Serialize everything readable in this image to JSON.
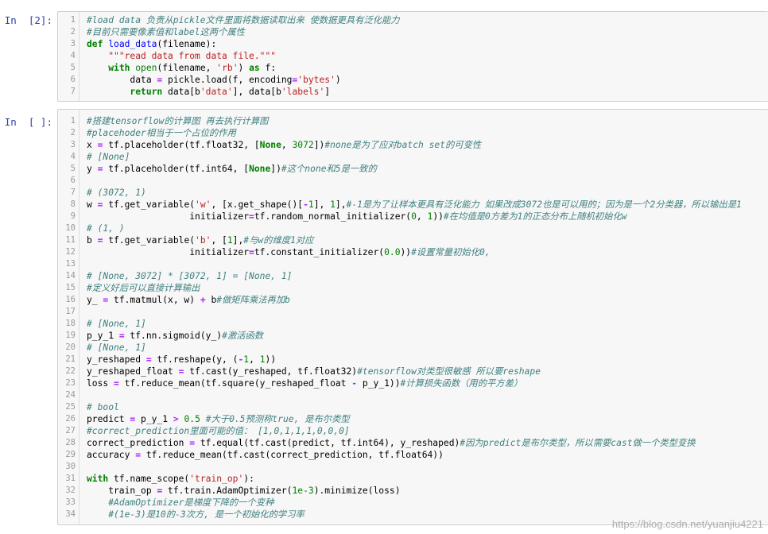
{
  "cells": [
    {
      "prompt": "In  [2]:",
      "lines": [
        [
          {
            "t": "#load data 负责从pickle文件里面将数据读取出来 使数据更具有泛化能力",
            "c": "cm"
          }
        ],
        [
          {
            "t": "#目前只需要像素值和label这两个属性",
            "c": "cm"
          }
        ],
        [
          {
            "t": "def",
            "c": "kw"
          },
          {
            "t": " "
          },
          {
            "t": "load_data",
            "c": "fn"
          },
          {
            "t": "(filename):"
          }
        ],
        [
          {
            "t": "    "
          },
          {
            "t": "\"\"\"read data from data file.\"\"\"",
            "c": "str"
          }
        ],
        [
          {
            "t": "    "
          },
          {
            "t": "with",
            "c": "kw"
          },
          {
            "t": " "
          },
          {
            "t": "open",
            "c": "bi"
          },
          {
            "t": "(filename, "
          },
          {
            "t": "'rb'",
            "c": "str"
          },
          {
            "t": ") "
          },
          {
            "t": "as",
            "c": "kw"
          },
          {
            "t": " f:"
          }
        ],
        [
          {
            "t": "        data "
          },
          {
            "t": "=",
            "c": "op"
          },
          {
            "t": " pickle.load(f, encoding"
          },
          {
            "t": "=",
            "c": "op"
          },
          {
            "t": "'bytes'",
            "c": "str"
          },
          {
            "t": ")"
          }
        ],
        [
          {
            "t": "        "
          },
          {
            "t": "return",
            "c": "kw"
          },
          {
            "t": " data[b"
          },
          {
            "t": "'data'",
            "c": "str"
          },
          {
            "t": "], data[b"
          },
          {
            "t": "'labels'",
            "c": "str"
          },
          {
            "t": "]"
          }
        ]
      ]
    },
    {
      "prompt": "In  [ ]:",
      "lines": [
        [
          {
            "t": "#搭建tensorflow的计算图 再去执行计算图",
            "c": "cm"
          }
        ],
        [
          {
            "t": "#placehoder相当于一个占位的作用",
            "c": "cm"
          }
        ],
        [
          {
            "t": "x "
          },
          {
            "t": "=",
            "c": "op"
          },
          {
            "t": " tf.placeholder(tf.float32, ["
          },
          {
            "t": "None",
            "c": "kw"
          },
          {
            "t": ", "
          },
          {
            "t": "3072",
            "c": "num"
          },
          {
            "t": "])"
          },
          {
            "t": "#none是为了应对batch set的可变性",
            "c": "cm"
          }
        ],
        [
          {
            "t": "# [None]",
            "c": "cm"
          }
        ],
        [
          {
            "t": "y "
          },
          {
            "t": "=",
            "c": "op"
          },
          {
            "t": " tf.placeholder(tf.int64, ["
          },
          {
            "t": "None",
            "c": "kw"
          },
          {
            "t": "])"
          },
          {
            "t": "#这个none和5是一致的",
            "c": "cm"
          }
        ],
        [
          {
            "t": ""
          }
        ],
        [
          {
            "t": "# (3072, 1)",
            "c": "cm"
          }
        ],
        [
          {
            "t": "w "
          },
          {
            "t": "=",
            "c": "op"
          },
          {
            "t": " tf.get_variable("
          },
          {
            "t": "'w'",
            "c": "str"
          },
          {
            "t": ", [x.get_shape()["
          },
          {
            "t": "-",
            "c": "op"
          },
          {
            "t": "1",
            "c": "num"
          },
          {
            "t": "], "
          },
          {
            "t": "1",
            "c": "num"
          },
          {
            "t": "],"
          },
          {
            "t": "#-1是为了让样本更具有泛化能力 如果改成3072也是可以用的；因为是一个2分类器，所以输出是1",
            "c": "cm"
          }
        ],
        [
          {
            "t": "                   initializer"
          },
          {
            "t": "=",
            "c": "op"
          },
          {
            "t": "tf.random_normal_initializer("
          },
          {
            "t": "0",
            "c": "num"
          },
          {
            "t": ", "
          },
          {
            "t": "1",
            "c": "num"
          },
          {
            "t": "))"
          },
          {
            "t": "#在均值是0方差为1的正态分布上随机初始化w",
            "c": "cm"
          }
        ],
        [
          {
            "t": "# (1, )",
            "c": "cm"
          }
        ],
        [
          {
            "t": "b "
          },
          {
            "t": "=",
            "c": "op"
          },
          {
            "t": " tf.get_variable("
          },
          {
            "t": "'b'",
            "c": "str"
          },
          {
            "t": ", ["
          },
          {
            "t": "1",
            "c": "num"
          },
          {
            "t": "],"
          },
          {
            "t": "#与w的维度1对应",
            "c": "cm"
          }
        ],
        [
          {
            "t": "                   initializer"
          },
          {
            "t": "=",
            "c": "op"
          },
          {
            "t": "tf.constant_initializer("
          },
          {
            "t": "0.0",
            "c": "num"
          },
          {
            "t": "))"
          },
          {
            "t": "#设置常量初始化0,",
            "c": "cm"
          }
        ],
        [
          {
            "t": ""
          }
        ],
        [
          {
            "t": "# [None, 3072] * [3072, 1] = [None, 1]",
            "c": "cm"
          }
        ],
        [
          {
            "t": "#定义好后可以直接计算输出",
            "c": "cm"
          }
        ],
        [
          {
            "t": "y_ "
          },
          {
            "t": "=",
            "c": "op"
          },
          {
            "t": " tf.matmul(x, w) "
          },
          {
            "t": "+",
            "c": "op"
          },
          {
            "t": " b"
          },
          {
            "t": "#做矩阵乘法再加b",
            "c": "cm"
          }
        ],
        [
          {
            "t": ""
          }
        ],
        [
          {
            "t": "# [None, 1]",
            "c": "cm"
          }
        ],
        [
          {
            "t": "p_y_1 "
          },
          {
            "t": "=",
            "c": "op"
          },
          {
            "t": " tf.nn.sigmoid(y_)"
          },
          {
            "t": "#激活函数",
            "c": "cm"
          }
        ],
        [
          {
            "t": "# [None, 1]",
            "c": "cm"
          }
        ],
        [
          {
            "t": "y_reshaped "
          },
          {
            "t": "=",
            "c": "op"
          },
          {
            "t": " tf.reshape(y, ("
          },
          {
            "t": "-",
            "c": "op"
          },
          {
            "t": "1",
            "c": "num"
          },
          {
            "t": ", "
          },
          {
            "t": "1",
            "c": "num"
          },
          {
            "t": "))"
          }
        ],
        [
          {
            "t": "y_reshaped_float "
          },
          {
            "t": "=",
            "c": "op"
          },
          {
            "t": " tf.cast(y_reshaped, tf.float32)"
          },
          {
            "t": "#tensorflow对类型很敏感 所以要reshape",
            "c": "cm"
          }
        ],
        [
          {
            "t": "loss "
          },
          {
            "t": "=",
            "c": "op"
          },
          {
            "t": " tf.reduce_mean(tf.square(y_reshaped_float "
          },
          {
            "t": "-",
            "c": "op"
          },
          {
            "t": " p_y_1))"
          },
          {
            "t": "#计算损失函数（用的平方差）",
            "c": "cm"
          }
        ],
        [
          {
            "t": ""
          }
        ],
        [
          {
            "t": "# bool",
            "c": "cm"
          }
        ],
        [
          {
            "t": "predict "
          },
          {
            "t": "=",
            "c": "op"
          },
          {
            "t": " p_y_1 "
          },
          {
            "t": ">",
            "c": "op"
          },
          {
            "t": " "
          },
          {
            "t": "0.5",
            "c": "num"
          },
          {
            "t": " "
          },
          {
            "t": "#大于0.5预测称true, 是布尔类型",
            "c": "cm"
          }
        ],
        [
          {
            "t": "#correct_prediction里面可能的值： [1,0,1,1,1,0,0,0]",
            "c": "cm"
          }
        ],
        [
          {
            "t": "correct_prediction "
          },
          {
            "t": "=",
            "c": "op"
          },
          {
            "t": " tf.equal(tf.cast(predict, tf.int64), y_reshaped)"
          },
          {
            "t": "#因为predict是布尔类型，所以需要cast做一个类型变换",
            "c": "cm"
          }
        ],
        [
          {
            "t": "accuracy "
          },
          {
            "t": "=",
            "c": "op"
          },
          {
            "t": " tf.reduce_mean(tf.cast(correct_prediction, tf.float64))"
          }
        ],
        [
          {
            "t": ""
          }
        ],
        [
          {
            "t": "with",
            "c": "kw"
          },
          {
            "t": " tf.name_scope("
          },
          {
            "t": "'train_op'",
            "c": "str"
          },
          {
            "t": "):"
          }
        ],
        [
          {
            "t": "    train_op "
          },
          {
            "t": "=",
            "c": "op"
          },
          {
            "t": " tf.train.AdamOptimizer("
          },
          {
            "t": "1e-3",
            "c": "num"
          },
          {
            "t": ").minimize(loss)"
          }
        ],
        [
          {
            "t": "    "
          },
          {
            "t": "#AdamOptimizer是梯度下降的一个变种",
            "c": "cm"
          }
        ],
        [
          {
            "t": "    "
          },
          {
            "t": "#(1e-3)是10的-3次方, 是一个初始化的学习率",
            "c": "cm"
          }
        ]
      ]
    }
  ],
  "watermark": "https://blog.csdn.net/yuanjiu4221"
}
